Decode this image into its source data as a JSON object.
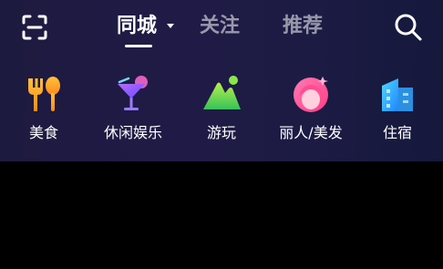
{
  "header": {
    "tabs": [
      {
        "label": "同城",
        "active": true
      },
      {
        "label": "关注",
        "active": false
      },
      {
        "label": "推荐",
        "active": false
      }
    ],
    "icons": {
      "left": "scan-icon",
      "right": "search-icon"
    }
  },
  "categories": [
    {
      "label": "美食",
      "icon": "fork-spoon-icon"
    },
    {
      "label": "休闲娱乐",
      "icon": "cocktail-icon"
    },
    {
      "label": "游玩",
      "icon": "mountain-icon"
    },
    {
      "label": "丽人/美发",
      "icon": "woman-face-icon"
    },
    {
      "label": "住宿",
      "icon": "building-icon"
    }
  ],
  "colors": {
    "panel_bg": "#1f1b45",
    "page_bg": "#000000",
    "active_tab": "#ffffff",
    "inactive_tab": "#8c8ba3"
  }
}
